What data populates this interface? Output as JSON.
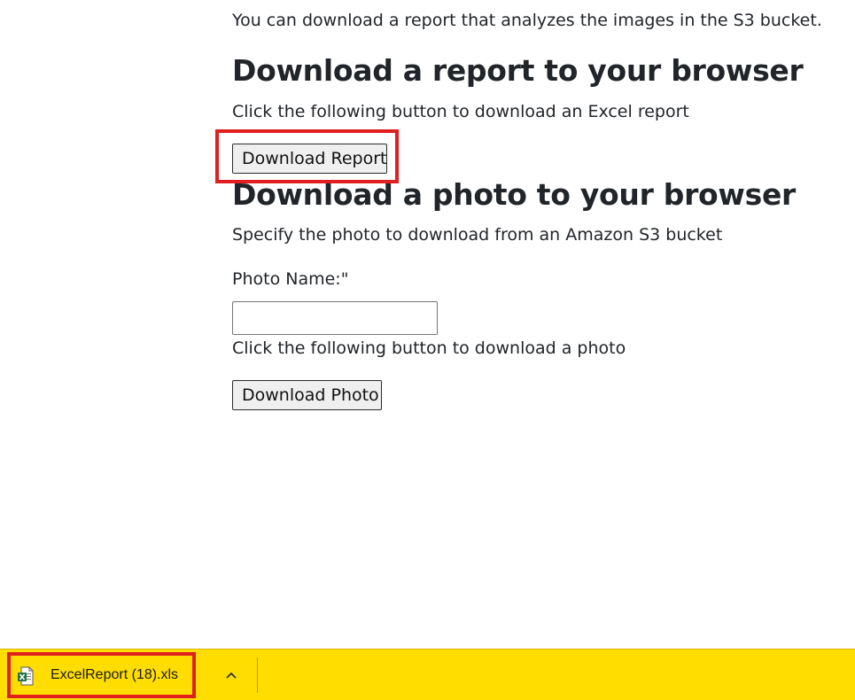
{
  "page": {
    "intro_text": "You can download a report that analyzes the images in the S3 bucket.",
    "report_section": {
      "heading": "Download a report to your browser",
      "description": "Click the following button to download an Excel report",
      "button_label": "Download Report"
    },
    "photo_section": {
      "heading": "Download a photo to your browser",
      "description": "Specify the photo to download from an Amazon S3 bucket",
      "photo_name_label": "Photo Name:\"",
      "photo_name_value": "",
      "download_hint": "Click the following button to download a photo",
      "button_label": "Download Photo"
    }
  },
  "download_bar": {
    "file_name": "ExcelReport (18).xls",
    "file_icon": "excel-file-icon",
    "caret_icon": "chevron-up-icon",
    "background_color": "#ffdd00"
  },
  "highlight_color": "#e0201f"
}
